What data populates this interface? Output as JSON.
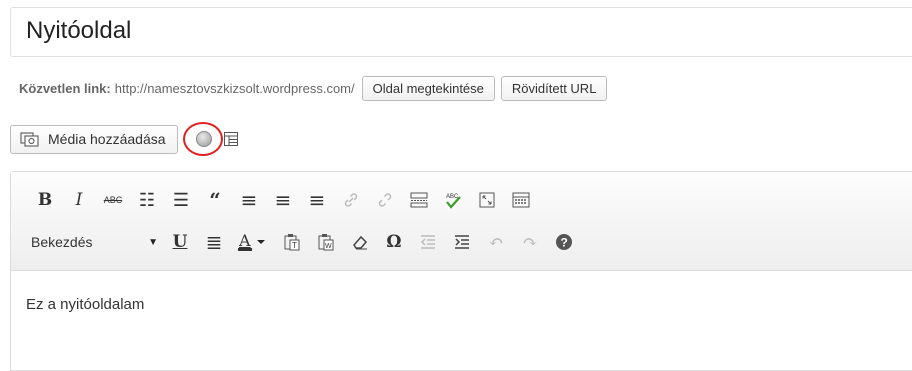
{
  "title": {
    "value": "Nyitóoldal"
  },
  "permalink": {
    "label": "Közvetlen link:",
    "url": "http://namesztovszkizsolt.wordpress.com/",
    "view_button": "Oldal megtekintése",
    "shortlink_button": "Rövidített URL"
  },
  "media": {
    "add_label": "Média hozzáadása",
    "icons": [
      "media-icon",
      "circle-button-icon",
      "form-icon"
    ]
  },
  "toolbar": {
    "row1": [
      {
        "name": "bold-button",
        "glyph": "B"
      },
      {
        "name": "italic-button",
        "glyph": "I"
      },
      {
        "name": "strikethrough-button",
        "glyph": "ABC"
      },
      {
        "name": "bullet-list-button",
        "glyph": "☰"
      },
      {
        "name": "numbered-list-button",
        "glyph": "☷"
      },
      {
        "name": "blockquote-button",
        "glyph": "❝"
      },
      {
        "name": "align-left-button",
        "glyph": "≡"
      },
      {
        "name": "align-center-button",
        "glyph": "≡"
      },
      {
        "name": "align-right-button",
        "glyph": "≡"
      },
      {
        "name": "insert-link-button",
        "glyph": "🔗"
      },
      {
        "name": "unlink-button",
        "glyph": "⛓"
      },
      {
        "name": "more-tag-button",
        "glyph": "▭"
      },
      {
        "name": "spellcheck-button",
        "glyph": "ABC✓"
      },
      {
        "name": "fullscreen-button",
        "glyph": "⤢"
      },
      {
        "name": "kitchen-sink-button",
        "glyph": "▤"
      }
    ],
    "format_select": {
      "selected": "Bekezdés"
    },
    "row2": [
      {
        "name": "underline-button",
        "glyph": "U"
      },
      {
        "name": "justify-button",
        "glyph": "≣"
      },
      {
        "name": "text-color-button",
        "glyph": "A"
      },
      {
        "name": "paste-text-button",
        "glyph": "📋"
      },
      {
        "name": "paste-word-button",
        "glyph": "📋"
      },
      {
        "name": "clear-formatting-button",
        "glyph": "⌫"
      },
      {
        "name": "special-character-button",
        "glyph": "Ω"
      },
      {
        "name": "outdent-button",
        "glyph": "⇤"
      },
      {
        "name": "indent-button",
        "glyph": "⇥"
      },
      {
        "name": "undo-button",
        "glyph": "↶"
      },
      {
        "name": "redo-button",
        "glyph": "↷"
      },
      {
        "name": "help-button",
        "glyph": "?"
      }
    ]
  },
  "editor": {
    "content": "Ez a nyitóoldalam"
  },
  "colors": {
    "annotation_ring": "#e02020",
    "border": "#dcdcdc"
  }
}
